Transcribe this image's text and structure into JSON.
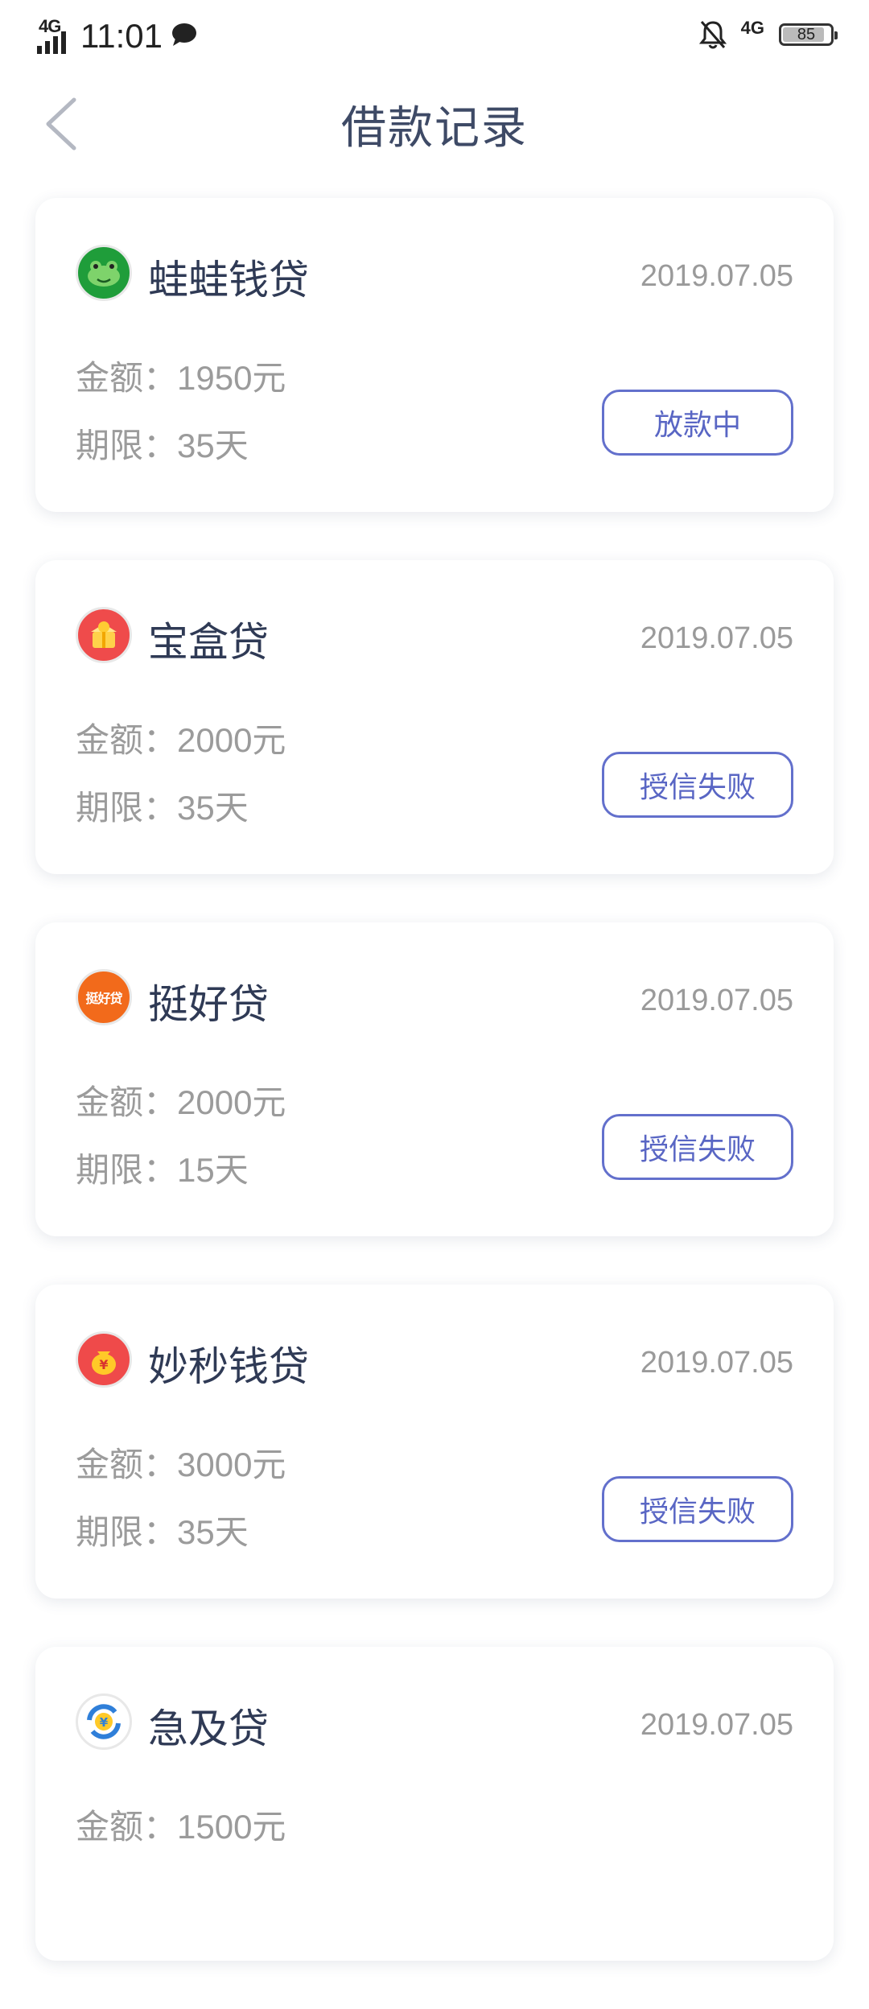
{
  "status_bar": {
    "network": "4G",
    "network_right": "4G",
    "time": "11:01",
    "battery": "85"
  },
  "nav": {
    "title": "借款记录"
  },
  "records": [
    {
      "name": "蛙蛙钱贷",
      "date": "2019.07.05",
      "amount": "金额：1950元",
      "term": "期限：35天",
      "status": "放款中",
      "logo": "frog-logo-icon",
      "logo_color": "#1f9d3a"
    },
    {
      "name": "宝盒贷",
      "date": "2019.07.05",
      "amount": "金额：2000元",
      "term": "期限：35天",
      "status": "授信失败",
      "logo": "treasure-box-logo-icon",
      "logo_color": "#ef4b4b"
    },
    {
      "name": "挺好贷",
      "date": "2019.07.05",
      "amount": "金额：2000元",
      "term": "期限：15天",
      "status": "授信失败",
      "logo": "tinghao-logo-icon",
      "logo_color": "#f26a1b",
      "logo_text": "挺好贷"
    },
    {
      "name": "妙秒钱贷",
      "date": "2019.07.05",
      "amount": "金额：3000元",
      "term": "期限：35天",
      "status": "授信失败",
      "logo": "money-bag-logo-icon",
      "logo_color": "#ef4a4a"
    },
    {
      "name": "急及贷",
      "date": "2019.07.05",
      "amount": "金额：1500元",
      "term": "",
      "status": "",
      "logo": "yen-exchange-logo-icon",
      "logo_color": "#2f7fd9"
    }
  ],
  "colors": {
    "accent": "#5966c4",
    "title": "#3e4a66",
    "muted": "#9b9b9b"
  }
}
